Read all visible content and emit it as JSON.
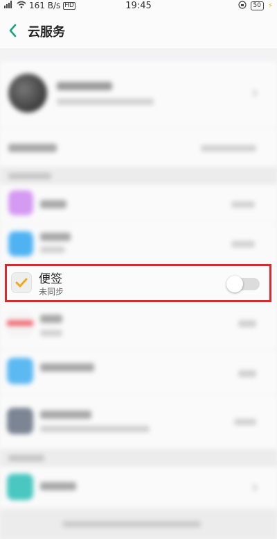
{
  "status_bar": {
    "speed": "161 B/s",
    "time": "19:45",
    "battery": "50"
  },
  "header": {
    "title": "云服务"
  },
  "note_item": {
    "title": "便签",
    "status": "未同步",
    "sync_enabled": false
  },
  "colors": {
    "accent": "#1aa37a",
    "highlight_border": "#e1262a",
    "note_check": "#f2a71b"
  }
}
